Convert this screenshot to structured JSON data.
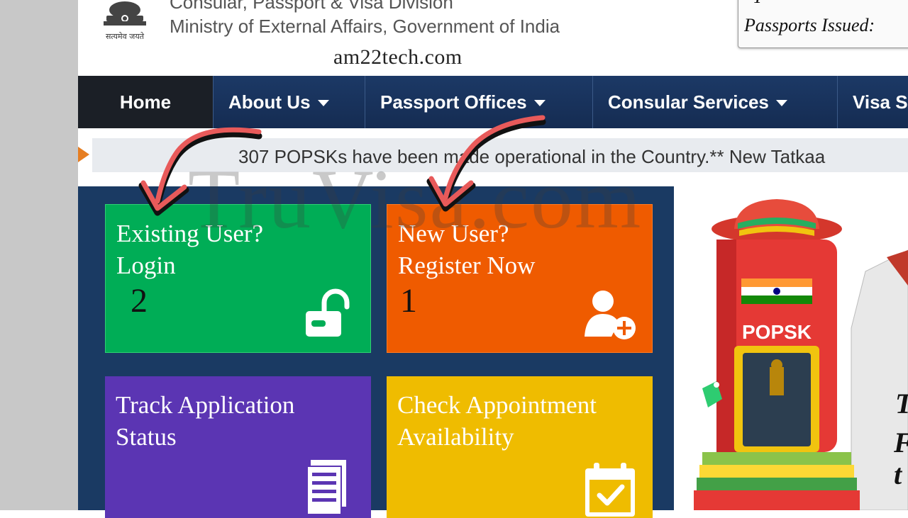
{
  "header": {
    "org_line1": "Consular, Passport & Visa Division",
    "org_line2": "Ministry of External Affairs, Government of India",
    "emblem_caption": "सत्यमेव जयते",
    "site_watermark": "am22tech.com",
    "stats_label": "Passports Issued:"
  },
  "nav": {
    "items": [
      {
        "label": "Home"
      },
      {
        "label": "About Us"
      },
      {
        "label": "Passport Offices"
      },
      {
        "label": "Consular Services"
      },
      {
        "label": "Visa S"
      }
    ]
  },
  "ticker": {
    "text": "307 POPSKs have been made operational in the Country.** New Tatkaa"
  },
  "tiles": {
    "login": {
      "line1": "Existing User?",
      "line2": "Login",
      "step": "2",
      "icon": "unlock-icon",
      "color": "#00ad56"
    },
    "register": {
      "line1": "New User?",
      "line2": "Register Now",
      "step": "1",
      "icon": "add-user-icon",
      "color": "#ef5b00"
    },
    "track": {
      "line1": "Track Application",
      "line2": "Status",
      "icon": "document-icon",
      "color": "#5b35b3"
    },
    "check": {
      "line1": "Check Appointment",
      "line2": "Availability",
      "icon": "calendar-check-icon",
      "color": "#efbc00"
    }
  },
  "promo": {
    "popsk_label": "POPSK",
    "side_text": [
      "T",
      "F",
      "t"
    ]
  },
  "watermark": "TruVisa.com",
  "colors": {
    "nav_bg": "#1c3966",
    "accent_arrow": "#e85a5a"
  }
}
